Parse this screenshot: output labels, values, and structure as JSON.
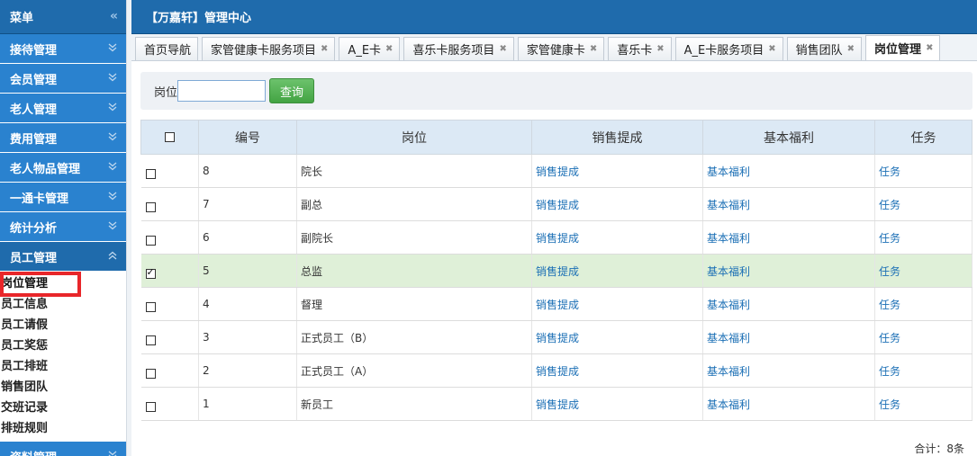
{
  "sidebar": {
    "title": "菜单",
    "collapse_glyph": "«",
    "items": [
      {
        "label": "接待管理"
      },
      {
        "label": "会员管理"
      },
      {
        "label": "老人管理"
      },
      {
        "label": "费用管理"
      },
      {
        "label": "老人物品管理"
      },
      {
        "label": "一通卡管理"
      },
      {
        "label": "统计分析"
      },
      {
        "label": "员工管理"
      }
    ],
    "sub_items": [
      {
        "label": "岗位管理"
      },
      {
        "label": "员工信息"
      },
      {
        "label": "员工请假"
      },
      {
        "label": "员工奖惩"
      },
      {
        "label": "员工排班"
      },
      {
        "label": "销售团队"
      },
      {
        "label": "交班记录"
      },
      {
        "label": "排班规则"
      }
    ],
    "bottom_item": "资料管理"
  },
  "header": {
    "title": "【万嘉轩】管理中心"
  },
  "tabs": [
    {
      "label": "首页导航",
      "closable": false
    },
    {
      "label": "家管健康卡服务项目",
      "closable": true
    },
    {
      "label": "A_E卡",
      "closable": true
    },
    {
      "label": "喜乐卡服务项目",
      "closable": true
    },
    {
      "label": "家管健康卡",
      "closable": true
    },
    {
      "label": "喜乐卡",
      "closable": true
    },
    {
      "label": "A_E卡服务项目",
      "closable": true
    },
    {
      "label": "销售团队",
      "closable": true
    },
    {
      "label": "岗位管理",
      "closable": true
    }
  ],
  "search": {
    "label": "岗位",
    "value": "",
    "button": "查询"
  },
  "table": {
    "headers": [
      "编号",
      "岗位",
      "销售提成",
      "基本福利",
      "任务"
    ],
    "link_sales": "销售提成",
    "link_welfare": "基本福利",
    "link_task": "任务",
    "rows": [
      {
        "id": "8",
        "name": "院长",
        "checked": false
      },
      {
        "id": "7",
        "name": "副总",
        "checked": false
      },
      {
        "id": "6",
        "name": "副院长",
        "checked": false
      },
      {
        "id": "5",
        "name": "总监",
        "checked": true
      },
      {
        "id": "4",
        "name": "督理",
        "checked": false
      },
      {
        "id": "3",
        "name": "正式员工（B）",
        "checked": false
      },
      {
        "id": "2",
        "name": "正式员工（A）",
        "checked": false
      },
      {
        "id": "1",
        "name": "新员工",
        "checked": false
      }
    ]
  },
  "footer": {
    "total": "合计：8条"
  }
}
